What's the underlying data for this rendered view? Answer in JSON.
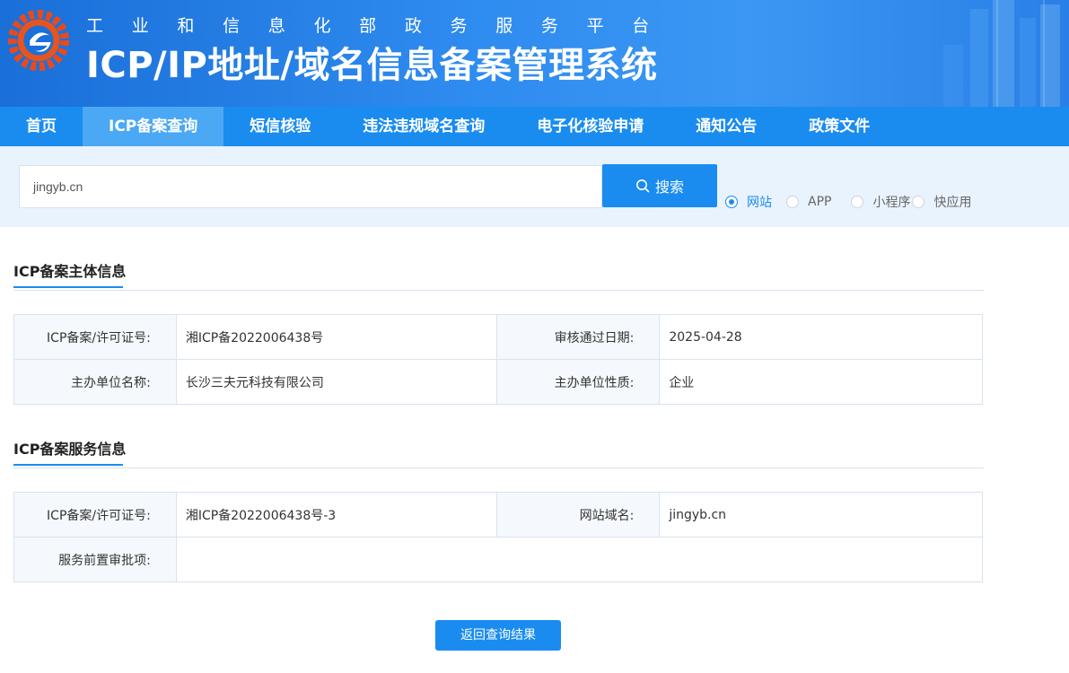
{
  "header": {
    "subtitle_chars": [
      "工",
      "业",
      "和",
      "信",
      "息",
      "化",
      "部",
      "政",
      "务",
      "服",
      "务",
      "平",
      "台"
    ],
    "title": "ICP/IP地址/域名信息备案管理系统"
  },
  "nav": {
    "items": [
      {
        "label": "首页"
      },
      {
        "label": "ICP备案查询",
        "active": true
      },
      {
        "label": "短信核验"
      },
      {
        "label": "违法违规域名查询"
      },
      {
        "label": "电子化核验申请"
      },
      {
        "label": "通知公告"
      },
      {
        "label": "政策文件"
      }
    ]
  },
  "search": {
    "value": "jingyb.cn",
    "button_label": "搜索",
    "options": [
      {
        "label": "网站",
        "checked": true
      },
      {
        "label": "APP",
        "checked": false
      },
      {
        "label": "小程序",
        "checked": false
      },
      {
        "label": "快应用",
        "checked": false
      }
    ]
  },
  "subject_info": {
    "title": "ICP备案主体信息",
    "license_label": "ICP备案/许可证号:",
    "license_value": "湘ICP备2022006438号",
    "approve_date_label": "审核通过日期:",
    "approve_date_value": "2025-04-28",
    "org_name_label": "主办单位名称:",
    "org_name_value": "长沙三夫元科技有限公司",
    "org_type_label": "主办单位性质:",
    "org_type_value": "企业"
  },
  "service_info": {
    "title": "ICP备案服务信息",
    "license_label": "ICP备案/许可证号:",
    "license_value": "湘ICP备2022006438号-3",
    "domain_label": "网站域名:",
    "domain_value": "jingyb.cn",
    "pre_approval_label": "服务前置审批项:",
    "pre_approval_value": ""
  },
  "back_button": "返回查询结果",
  "colors": {
    "primary": "#1a8cf0",
    "nav_active": "#4aa8f5",
    "search_bg": "#e9f3fd"
  }
}
